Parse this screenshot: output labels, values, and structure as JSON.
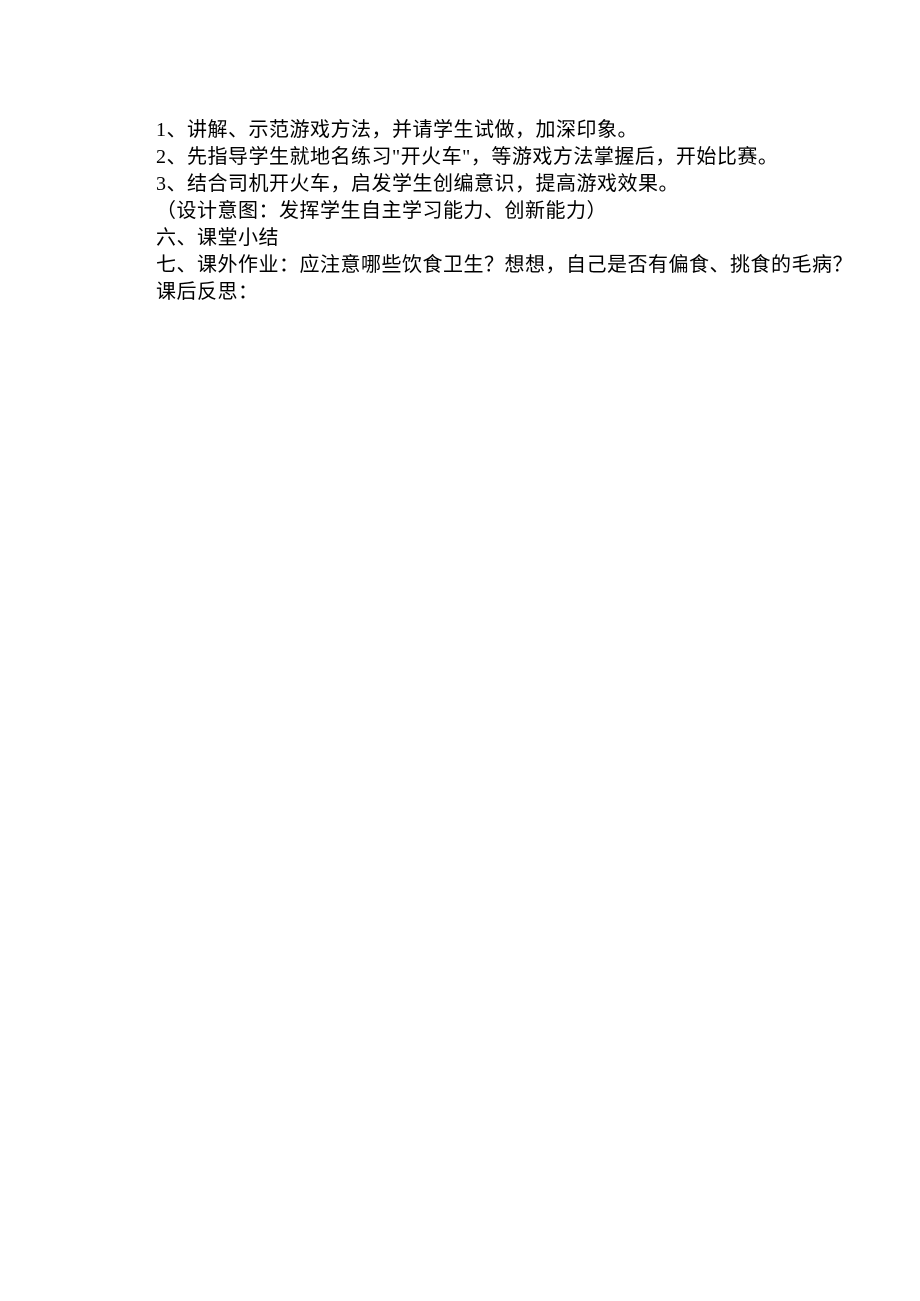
{
  "lines": {
    "l1": "1、讲解、示范游戏方法，并请学生试做，加深印象。",
    "l2": "2、先指导学生就地名练习\"开火车\"，等游戏方法掌握后，开始比赛。",
    "l3": "3、结合司机开火车，启发学生创编意识，提高游戏效果。",
    "l4": "（设计意图：发挥学生自主学习能力、创新能力）",
    "l5": "六、课堂小结",
    "l6": "七、课外作业：应注意哪些饮食卫生？想想，自己是否有偏食、挑食的毛病？",
    "l7": "课后反思："
  }
}
